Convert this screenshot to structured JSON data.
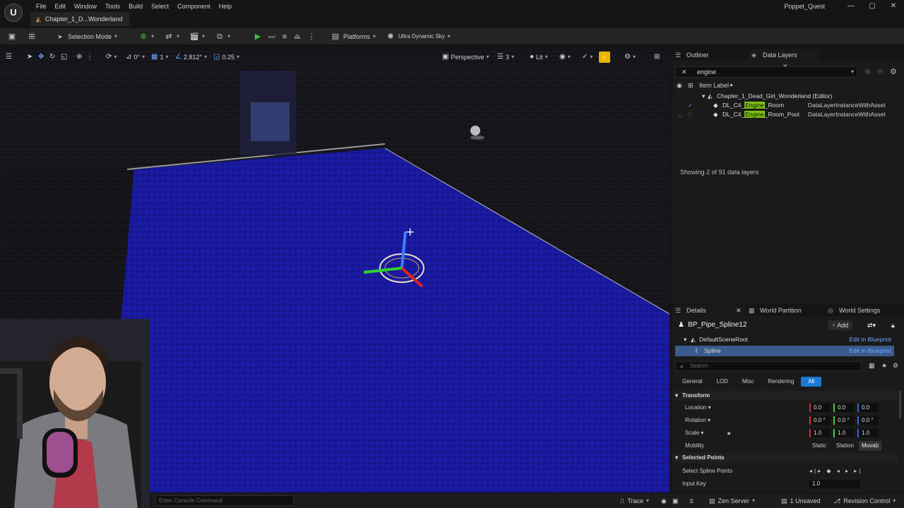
{
  "app": {
    "logo": "U",
    "project_name": "Poppet_Quest",
    "window_controls": [
      "—",
      "▢",
      "✕"
    ]
  },
  "menu": [
    "File",
    "Edit",
    "Window",
    "Tools",
    "Build",
    "Select",
    "Component",
    "Help"
  ],
  "document_tab": "Chapter_1_D...Wonderland",
  "toolbar": {
    "selection_mode": "Selection Mode",
    "platforms": "Platforms",
    "sky": "Ultra Dynamic Sky"
  },
  "viewport": {
    "rotate_snap": "0°",
    "grid_snap": "1",
    "angle_value": "2.812°",
    "scale_snap": "0.25",
    "view_mode": "Perspective",
    "lighting": "Lit",
    "camera_speed": "3"
  },
  "statusbar": {
    "console_placeholder": "Enter Console Command",
    "trace": "Trace",
    "zen_server": "Zen Server",
    "unsaved": "1 Unsaved",
    "revision_control": "Revision Control"
  },
  "outliner": {
    "tabs": [
      "Outliner",
      "Data Layers"
    ],
    "search_value": "engine",
    "column_header": "Item Label",
    "tree": {
      "root": "Chapter_1_Dead_Girl_Wonderland (Editor)",
      "items": [
        {
          "prefix": "DL_C4_",
          "match": "Engine",
          "suffix": "_Room",
          "type": "DataLayerInstanceWithAsset",
          "checked": true
        },
        {
          "prefix": "DL_C4_",
          "match": "Engine",
          "suffix": "_Room_Pool",
          "type": "DataLayerInstanceWithAsset",
          "checked": false
        }
      ]
    },
    "showing": "Showing 2 of 91 data layers"
  },
  "details": {
    "tabs": [
      "Details",
      "World Partition",
      "World Settings"
    ],
    "actor_name": "BP_Pipe_Spline12",
    "add_label": "Add",
    "components": [
      {
        "name": "DefaultSceneRoot",
        "action": "Edit in Blueprint"
      },
      {
        "name": "Spline",
        "action": "Edit in Blueprint"
      }
    ],
    "search_placeholder": "Search",
    "filters": [
      "General",
      "LOD",
      "Misc",
      "Rendering",
      "All"
    ],
    "active_filter": "All",
    "transform_section": "Transform",
    "location_label": "Location",
    "location": [
      "0.0",
      "0.0",
      "0.0"
    ],
    "rotation_label": "Rotation",
    "rotation": [
      "0.0 °",
      "0.0 °",
      "0.0 °"
    ],
    "scale_label": "Scale",
    "scale": [
      "1.0",
      "1.0",
      "1.0"
    ],
    "mobility_label": "Mobility",
    "mobility": [
      "Static",
      "Station",
      "Movab"
    ],
    "selected_points_section": "Selected Points",
    "select_spline_points": "Select Spline Points",
    "input_key_label": "Input Key",
    "input_key": "1.0"
  },
  "colors": {
    "accent_blue": "#1a7ad6",
    "highlight_green": "#7ec214",
    "floor_blue": "#1a1aa0"
  }
}
